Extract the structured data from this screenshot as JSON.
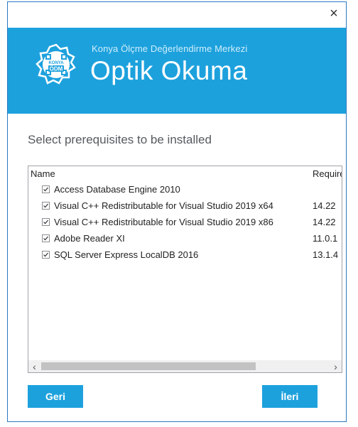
{
  "window": {
    "close_glyph": "×"
  },
  "banner": {
    "logo_text_top": "KONYA",
    "logo_text_main": "ÖDM",
    "org_name": "Konya Ölçme Değerlendirme Merkezi",
    "app_title": "Optik Okuma",
    "color": "#1da1dd"
  },
  "page": {
    "heading": "Select prerequisites to be installed"
  },
  "list": {
    "columns": {
      "name": "Name",
      "required": "Required"
    },
    "rows": [
      {
        "name": "Access Database Engine 2010",
        "version": "",
        "checked": true
      },
      {
        "name": "Visual C++ Redistributable for Visual Studio 2019 x64",
        "version": "14.22",
        "checked": true
      },
      {
        "name": "Visual C++ Redistributable for Visual Studio 2019 x86",
        "version": "14.22",
        "checked": true
      },
      {
        "name": "Adobe Reader XI",
        "version": "11.0.1",
        "checked": true
      },
      {
        "name": "SQL Server Express LocalDB 2016",
        "version": "13.1.4",
        "checked": true
      }
    ],
    "scroll_left_glyph": "‹",
    "scroll_right_glyph": "›"
  },
  "buttons": {
    "back": "Geri",
    "next": "İleri"
  }
}
